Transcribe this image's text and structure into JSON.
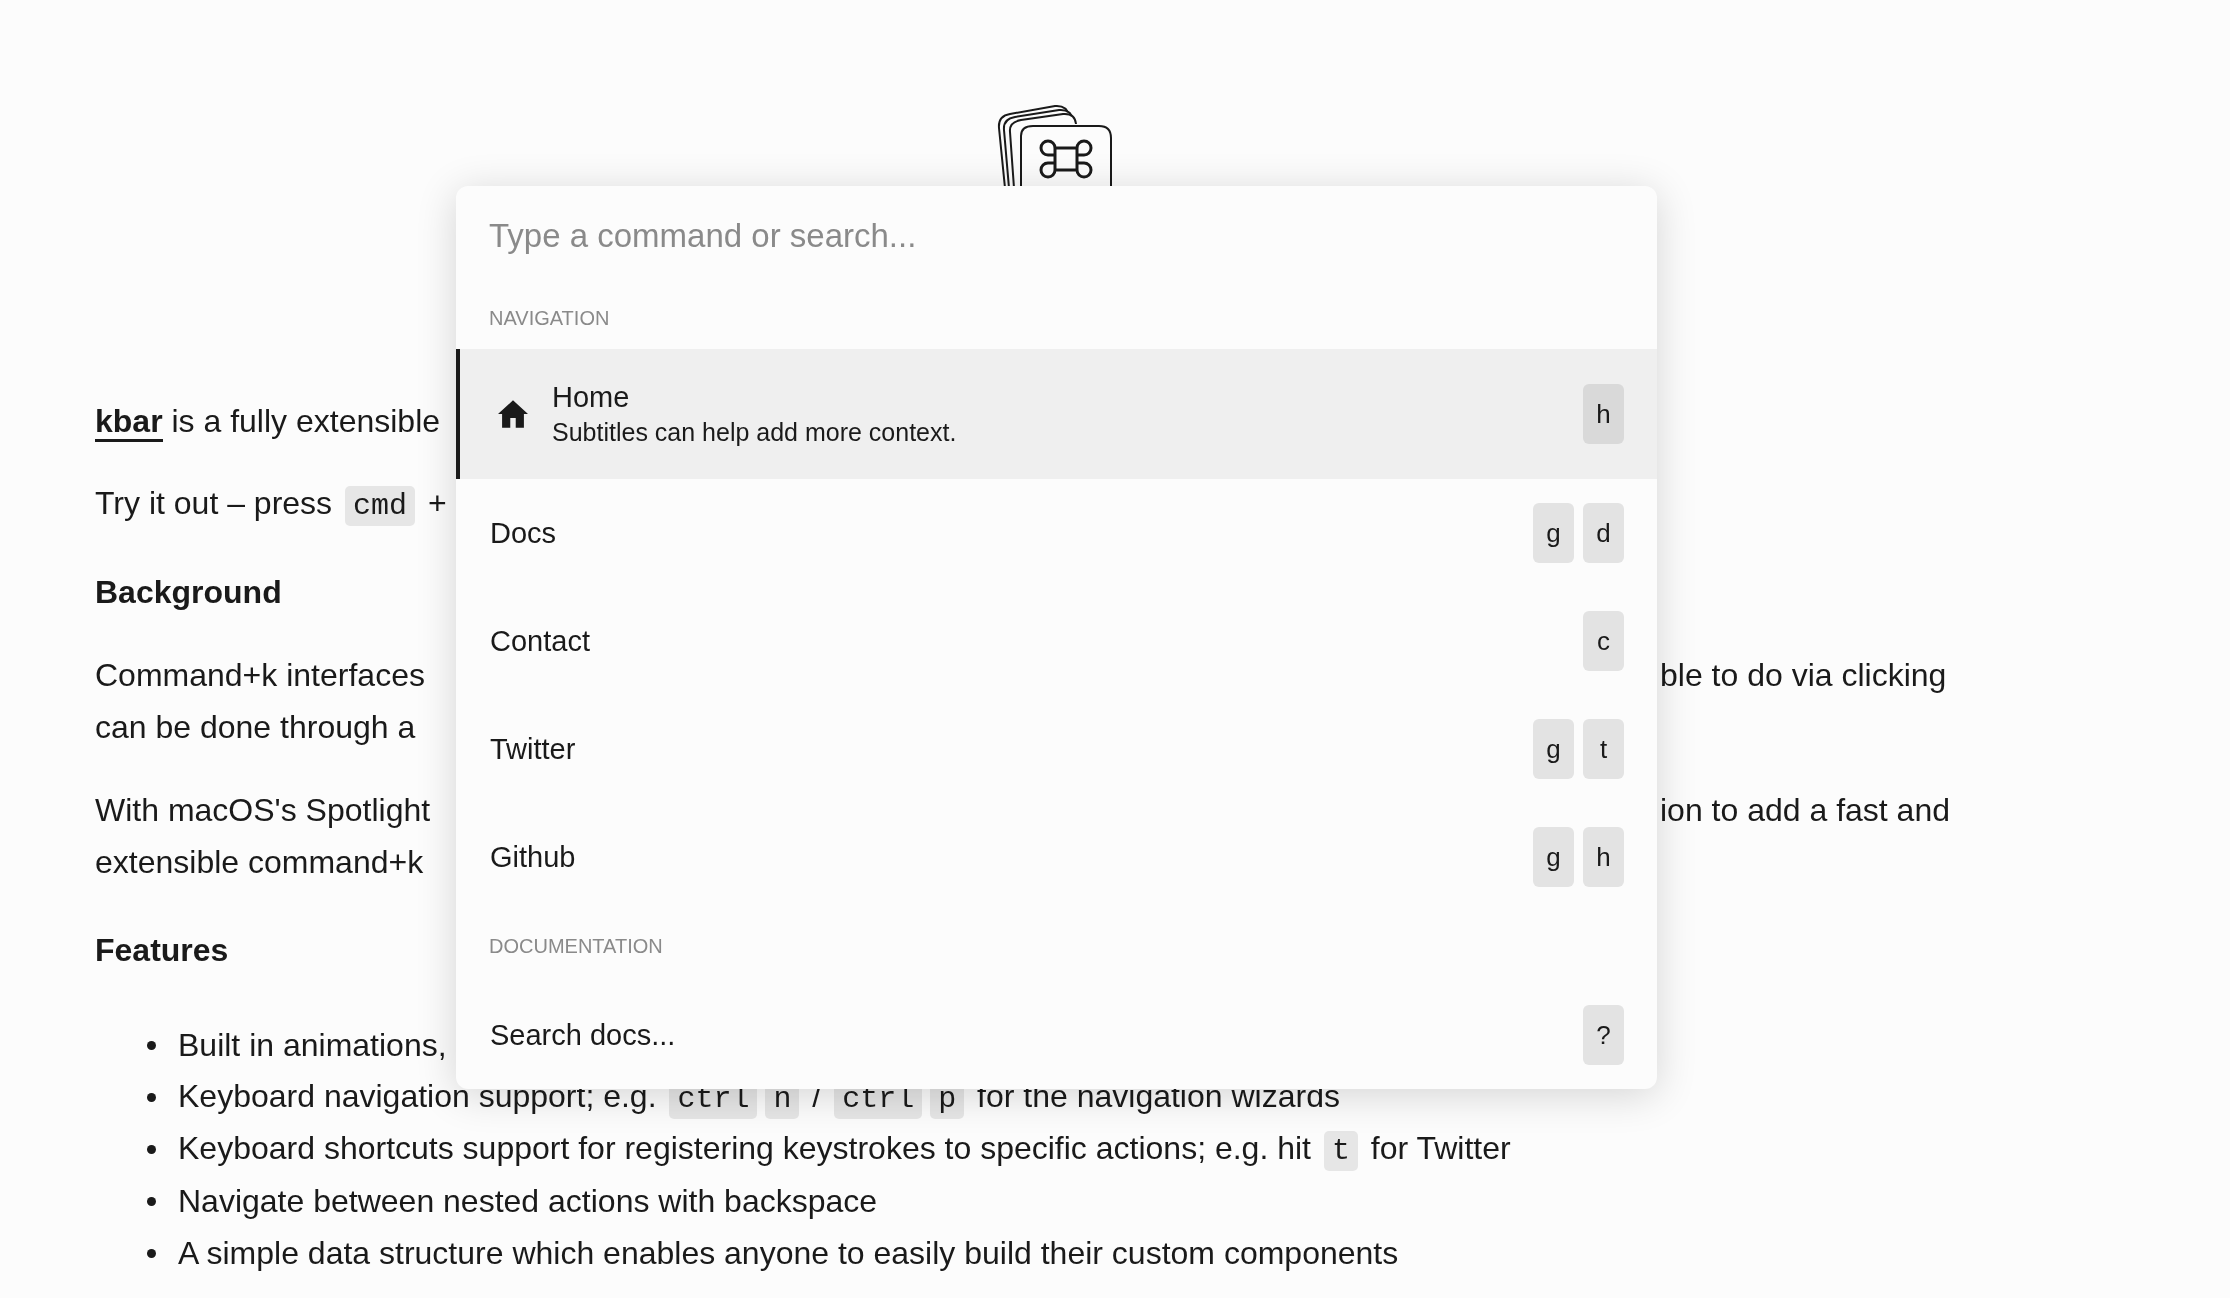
{
  "paragraphs": [
    {
      "kind": "text",
      "left": [
        {
          "kind": "link",
          "text": "kbar"
        },
        {
          "kind": "text",
          "text": " is a fully extensible"
        }
      ]
    },
    {
      "kind": "text",
      "left": [
        {
          "kind": "text",
          "text": "Try it out – press "
        },
        {
          "kind": "code",
          "text": "cmd"
        },
        {
          "kind": "text",
          "text": " +"
        }
      ]
    },
    {
      "kind": "heading",
      "left": [
        {
          "kind": "text",
          "text": "Background"
        }
      ]
    },
    {
      "kind": "text",
      "left": [
        {
          "kind": "text",
          "text": "Command+k interfaces"
        }
      ],
      "right": "ble to do via clicking"
    },
    {
      "kind": "continued",
      "left": [
        {
          "kind": "text",
          "text": "can be done through a"
        }
      ]
    },
    {
      "kind": "text",
      "left": [
        {
          "kind": "text",
          "text": "With macOS's Spotlight"
        }
      ],
      "right": "ion to add a fast and"
    },
    {
      "kind": "continued",
      "left": [
        {
          "kind": "text",
          "text": "extensible command+k"
        }
      ]
    },
    {
      "kind": "heading",
      "left": [
        {
          "kind": "text",
          "text": "Features"
        }
      ]
    }
  ],
  "features": [
    [
      {
        "kind": "text",
        "text": "Built in animations,"
      }
    ],
    [
      {
        "kind": "text",
        "text": "Keyboard navigation support; e.g. "
      },
      {
        "kind": "code",
        "text": "ctrl"
      },
      {
        "kind": "code",
        "text": "n"
      },
      {
        "kind": "text",
        "text": " / "
      },
      {
        "kind": "code",
        "text": "ctrl"
      },
      {
        "kind": "code",
        "text": "p"
      },
      {
        "kind": "text",
        "text": " for the navigation wizards"
      }
    ],
    [
      {
        "kind": "text",
        "text": "Keyboard shortcuts support for registering keystrokes to specific actions; e.g. hit "
      },
      {
        "kind": "code",
        "text": "t"
      },
      {
        "kind": "text",
        "text": " for Twitter"
      }
    ],
    [
      {
        "kind": "text",
        "text": "Navigate between nested actions with backspace"
      }
    ],
    [
      {
        "kind": "text",
        "text": "A simple data structure which enables anyone to easily build their custom components"
      }
    ]
  ],
  "command_palette": {
    "search": {
      "placeholder": "Type a command or search..."
    },
    "sections": [
      {
        "title": "NAVIGATION",
        "items": [
          {
            "kind": "detailed",
            "label": "Home",
            "subtitle": "Subtitles can help add more context.",
            "selected": true,
            "shortcut": [
              "h"
            ]
          },
          {
            "label": "Docs",
            "selected": false,
            "shortcut": [
              "g",
              "d"
            ]
          },
          {
            "label": "Contact",
            "selected": false,
            "shortcut": [
              "c"
            ]
          },
          {
            "label": "Twitter",
            "selected": false,
            "shortcut": [
              "g",
              "t"
            ]
          },
          {
            "label": "Github",
            "selected": false,
            "shortcut": [
              "g",
              "h"
            ]
          }
        ]
      },
      {
        "title": "DOCUMENTATION",
        "items": [
          {
            "label": "Search docs...",
            "selected": false,
            "shortcut": [
              "?"
            ]
          }
        ]
      }
    ]
  }
}
